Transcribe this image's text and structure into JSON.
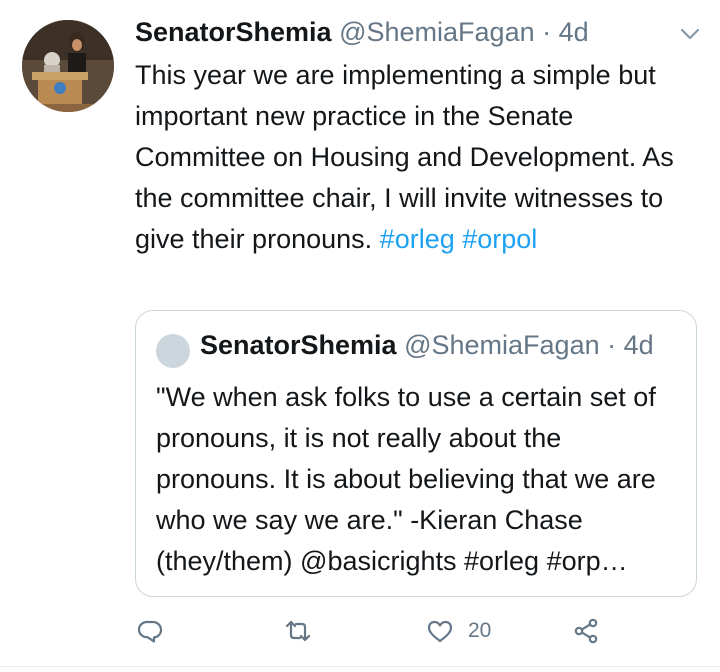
{
  "tweet": {
    "display_name": "SenatorShemia",
    "handle": "@ShemiaFagan",
    "separator": "·",
    "time": "4d",
    "text": "This year we are implementing a simple but important new practice in the Senate Committee on Housing and Development. As the committee chair, I will invite witnesses to give their pronouns.",
    "hashtags": [
      "#orleg",
      "#orpol"
    ]
  },
  "quoted_tweet": {
    "display_name": "SenatorShemia",
    "handle": "@ShemiaFagan",
    "separator": "·",
    "time": "4d",
    "text": "\"We when ask folks to use a certain set of pronouns, it is not really about the pronouns.  It is about believing that we are who we say we are.\" -Kieran Chase (they/them) @basicrights #orleg #orp…"
  },
  "actions": {
    "reply_icon": "reply-icon",
    "retweet_icon": "retweet-icon",
    "like_icon": "heart-icon",
    "like_count": "20",
    "share_icon": "share-icon"
  },
  "colors": {
    "link": "#1da1f2",
    "secondary_text": "#657786",
    "border": "#ccd6dd"
  }
}
